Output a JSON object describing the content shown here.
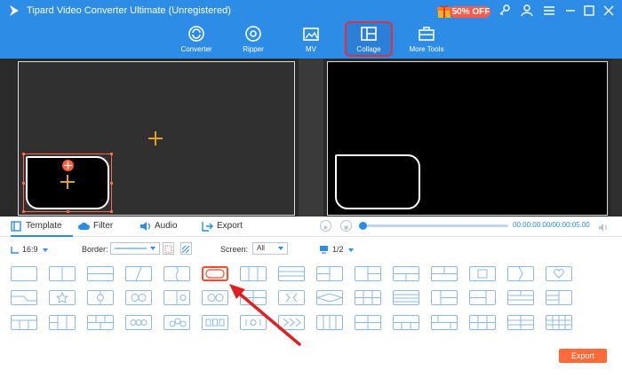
{
  "window": {
    "title": "Tipard Video Converter Ultimate (Unregistered)"
  },
  "promo": {
    "label": "50% OFF"
  },
  "nav": [
    {
      "label": "Converter",
      "icon": "converter-icon"
    },
    {
      "label": "Ripper",
      "icon": "ripper-icon"
    },
    {
      "label": "MV",
      "icon": "mv-icon"
    },
    {
      "label": "Collage",
      "icon": "collage-icon",
      "active": true
    },
    {
      "label": "More Tools",
      "icon": "toolbox-icon"
    }
  ],
  "tabs": [
    {
      "label": "Template",
      "icon": "template-icon",
      "active": true
    },
    {
      "label": "Filter",
      "icon": "cloud-icon"
    },
    {
      "label": "Audio",
      "icon": "audio-icon"
    },
    {
      "label": "Export",
      "icon": "export-icon"
    }
  ],
  "playback": {
    "timecode": "00:00:00.00/00:00:05.00"
  },
  "options": {
    "aspect_ratio": "16:9",
    "border_label": "Border:",
    "screen_label": "Screen:",
    "screen_value": "All",
    "page": "1/2"
  },
  "export_button": "Export",
  "colors": {
    "accent": "#2d8ce6",
    "highlight": "#e0303c",
    "export": "#ff6a3a"
  }
}
